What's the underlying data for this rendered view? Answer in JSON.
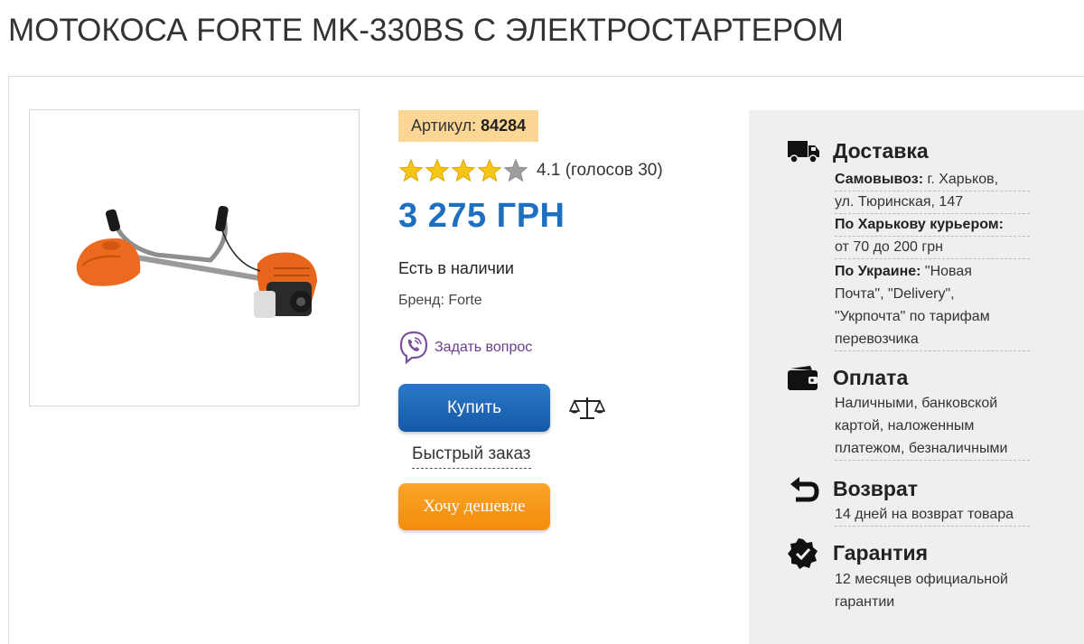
{
  "product": {
    "title": "МОТОКОСА FORTE MK-330BS С ЭЛЕКТРОСТАРТЕРОМ",
    "sku_label": "Артикул:",
    "sku_value": "84284",
    "rating_value": 4.1,
    "rating_text": "4.1 (голосов 30)",
    "price": "3 275 ГРН",
    "availability": "Есть в наличии",
    "brand": "Бренд: Forte",
    "ask_question": "Задать вопрос",
    "buy_label": "Купить",
    "quick_order_label": "Быстрый заказ",
    "cheaper_label": "Хочу дешевле",
    "image_icon": "grass-trimmer-photo"
  },
  "info": {
    "delivery": {
      "icon": "truck-icon",
      "title": "Доставка",
      "pickup_label": "Самовывоз:",
      "pickup_text_1": " г. Харьков,",
      "pickup_text_2": "ул. Тюринская, 147",
      "courier_label": "По Харькову курьером:",
      "courier_text": "от 70 до 200 грн",
      "ukraine_label": "По Украине:",
      "ukraine_text_1": " \"Новая",
      "ukraine_text_2": "Почта\", \"Delivery\",",
      "ukraine_text_3": "\"Укрпочта\" по тарифам",
      "ukraine_text_4": "перевозчика"
    },
    "payment": {
      "icon": "wallet-icon",
      "title": "Оплата",
      "line_1": "Наличными, банковской",
      "line_2": "картой, наложенным",
      "line_3": "платежом, безналичными"
    },
    "return": {
      "icon": "return-arrow-icon",
      "title": "Возврат",
      "line_1": "14 дней на возврат товара"
    },
    "warranty": {
      "icon": "badge-check-icon",
      "title": "Гарантия",
      "line_1": "12 месяцев официальной",
      "line_2": "гарантии"
    }
  },
  "colors": {
    "price": "#1f6fc0",
    "buy_button": "#1a66b8",
    "cheaper_button": "#f7961a",
    "sku_badge": "#fcd694",
    "star": "#f5c518",
    "viber": "#7b519d"
  }
}
